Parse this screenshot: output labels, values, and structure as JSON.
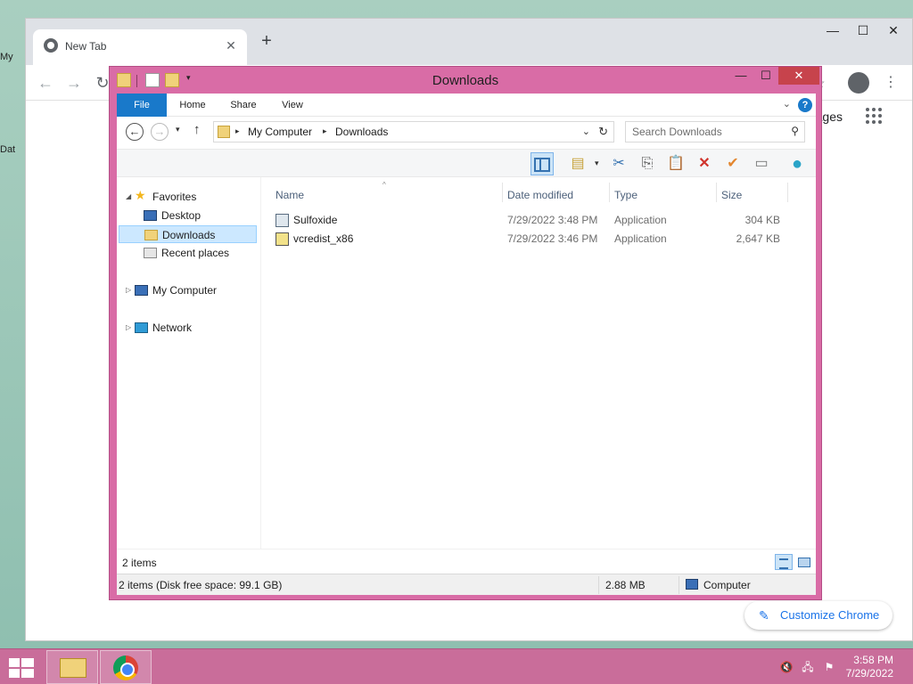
{
  "desktop": {
    "icons": [
      {
        "label": "My"
      },
      {
        "label": "Dat"
      }
    ]
  },
  "chrome": {
    "tab_title": "New Tab",
    "tab_close": "✕",
    "new_tab": "+",
    "minimize": "—",
    "maximize": "☐",
    "close": "✕",
    "back": "←",
    "forward": "→",
    "reload": "↻",
    "star": "☆",
    "menu": "⋮",
    "images_link": "ages",
    "customize_label": "Customize Chrome",
    "customize_icon": "✎"
  },
  "explorer": {
    "title": "Downloads",
    "minimize": "—",
    "maximize": "☐",
    "close": "✕",
    "ribbon_tabs": [
      "File",
      "Home",
      "Share",
      "View"
    ],
    "ribbon_expand": "⌄",
    "help": "?",
    "address": {
      "back": "←",
      "forward": "→",
      "recent": "▾",
      "up": "↑",
      "crumbs": [
        "My Computer",
        "Downloads"
      ],
      "crumb_sep": "▸",
      "dropdown": "⌄",
      "refresh": "↻"
    },
    "search": {
      "placeholder": "Search Downloads",
      "icon": "⚲"
    },
    "toolbar": {
      "dropdown": "▾",
      "cut": "✂",
      "copy": "⎘",
      "paste": "📋",
      "delete": "✕",
      "check": "✔",
      "rename": "▭",
      "globe": "●"
    },
    "nav": {
      "expander_open": "◢",
      "expander_closed": "▷",
      "favorites": "Favorites",
      "favorites_icon": "★",
      "desktop": "Desktop",
      "downloads": "Downloads",
      "recent": "Recent places",
      "my_computer": "My Computer",
      "network": "Network"
    },
    "columns": {
      "name": "Name",
      "date": "Date modified",
      "type": "Type",
      "size": "Size",
      "sort": "^"
    },
    "files": [
      {
        "name": "Sulfoxide",
        "date": "7/29/2022 3:48 PM",
        "type": "Application",
        "size": "304 KB"
      },
      {
        "name": "vcredist_x86",
        "date": "7/29/2022 3:46 PM",
        "type": "Application",
        "size": "2,647 KB"
      }
    ],
    "items_count": "2 items",
    "status": {
      "summary": "2 items (Disk free space: 99.1 GB)",
      "size": "2.88 MB",
      "location": "Computer"
    }
  },
  "taskbar": {
    "time": "3:58 PM",
    "date": "7/29/2022",
    "tray_volume": "🔇",
    "tray_network": "🖧",
    "tray_flag": "⚑"
  },
  "colors": {
    "accent": "#d96ca6",
    "file_tab": "#1979ca",
    "taskbar": "#c96d9a"
  }
}
